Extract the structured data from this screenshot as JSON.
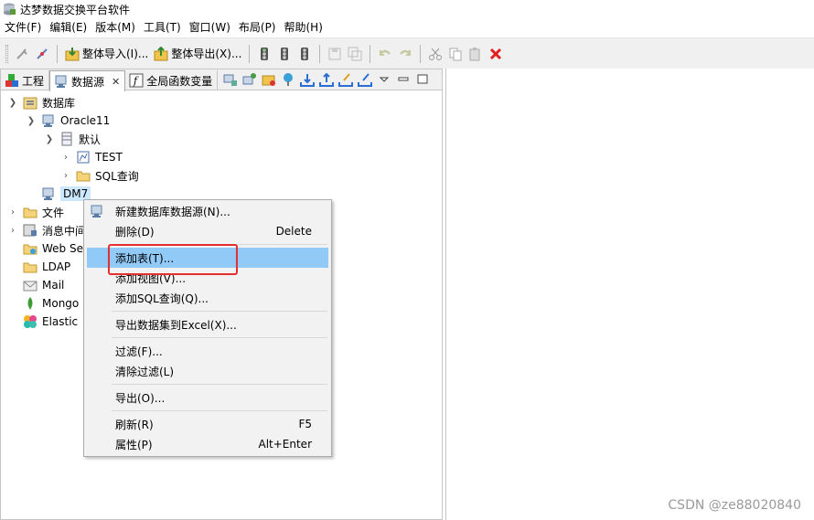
{
  "window": {
    "title": "达梦数据交换平台软件",
    "icon": "app-db-icon"
  },
  "menubar": [
    "文件(F)",
    "编辑(E)",
    "版本(M)",
    "工具(T)",
    "窗口(W)",
    "布局(P)",
    "帮助(H)"
  ],
  "toolbar": {
    "import_all": "整体导入(I)...",
    "export_all": "整体导出(X)..."
  },
  "tabs": [
    {
      "label": "工程",
      "icon": "project-icon",
      "active": false
    },
    {
      "label": "数据源",
      "icon": "datasource-icon",
      "active": true,
      "close": "✕"
    },
    {
      "label": "全局函数变量",
      "icon": "function-icon",
      "active": false
    }
  ],
  "tree": {
    "root": "数据库",
    "oracle": "Oracle11",
    "default_schema": "默认",
    "test_table": "TEST",
    "sql_query": "SQL查询",
    "dm7": "DM7",
    "file": "文件",
    "middleware": "消息中间件",
    "webservice": "Web Se",
    "ldap": "LDAP",
    "mail": "Mail",
    "mongo": "Mongo",
    "elastic": "Elastic"
  },
  "context_menu": {
    "new_ds": "新建数据库数据源(N)...",
    "delete": "删除(D)",
    "delete_shortcut": "Delete",
    "add_table": "添加表(T)...",
    "add_view": "添加视图(V)...",
    "add_sql": "添加SQL查询(Q)...",
    "export_excel": "导出数据集到Excel(X)...",
    "filter": "过滤(F)...",
    "clear_filter": "清除过滤(L)",
    "export": "导出(O)...",
    "refresh": "刷新(R)",
    "refresh_shortcut": "F5",
    "properties": "属性(P)",
    "properties_shortcut": "Alt+Enter"
  },
  "watermark": "CSDN @ze88020840",
  "colors": {
    "highlight": "#91c9f7",
    "annotation_box": "#e32f2f",
    "selection": "#cce8ff"
  }
}
